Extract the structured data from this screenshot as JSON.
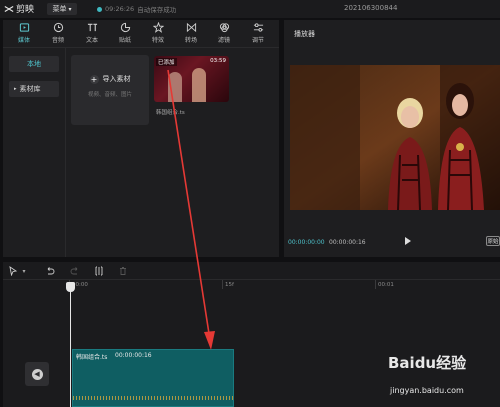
{
  "app": {
    "name": "剪映",
    "menu_label": "菜单",
    "save_time": "09:26:26",
    "save_status": "自动保存成功",
    "project_title": "202106300844"
  },
  "media_toolbar": {
    "tabs": [
      {
        "label": "媒体",
        "icon": "media-icon",
        "active": true
      },
      {
        "label": "音频",
        "icon": "audio-icon"
      },
      {
        "label": "文本",
        "icon": "text-icon"
      },
      {
        "label": "贴纸",
        "icon": "sticker-icon"
      },
      {
        "label": "特效",
        "icon": "effects-icon"
      },
      {
        "label": "转场",
        "icon": "transition-icon"
      },
      {
        "label": "滤镜",
        "icon": "filter-icon"
      },
      {
        "label": "调节",
        "icon": "adjust-icon"
      }
    ]
  },
  "side_nav": {
    "local": "本地",
    "library": "素材库"
  },
  "import_card": {
    "label": "导入素材",
    "hint": "视频、音频、图片"
  },
  "media_item": {
    "badge": "已添加",
    "duration": "03:59",
    "filename": "韩国组合.ts"
  },
  "player": {
    "title": "播放器",
    "current_time": "00:00:00:00",
    "total_time": "00:00:00:16",
    "ratio_label": "原始"
  },
  "timeline": {
    "ruler_labels": [
      "00:00",
      "15f",
      "00:01"
    ],
    "clip_name": "韩国组合.ts",
    "clip_duration": "00:00:00:16"
  },
  "watermark": {
    "brand": "Baidu经验",
    "url": "jingyan.baidu.com"
  },
  "colors": {
    "accent": "#4fc3cc",
    "clip": "#0f5e62",
    "annotation": "#e53935"
  }
}
